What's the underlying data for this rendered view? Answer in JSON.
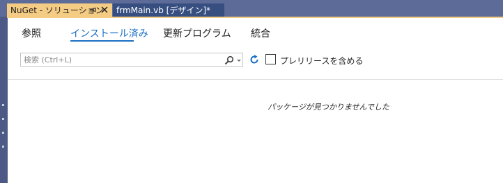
{
  "tabs": [
    {
      "label": "NuGet - ソリューション",
      "active": true
    },
    {
      "label": "frmMain.vb [デザイン]*",
      "active": false
    }
  ],
  "nav": {
    "browse": "参照",
    "installed": "インストール済み",
    "updates": "更新プログラム",
    "consolidate": "統合"
  },
  "search": {
    "placeholder": "検索 (Ctrl+L)"
  },
  "prerelease_label": "プレリリースを含める",
  "empty_message": "パッケージが見つかりませんでした",
  "colors": {
    "accent": "#1a6fc4",
    "active_tab": "#f5cc84",
    "inactive_tab": "#364e80",
    "chrome": "#5d6b99"
  }
}
